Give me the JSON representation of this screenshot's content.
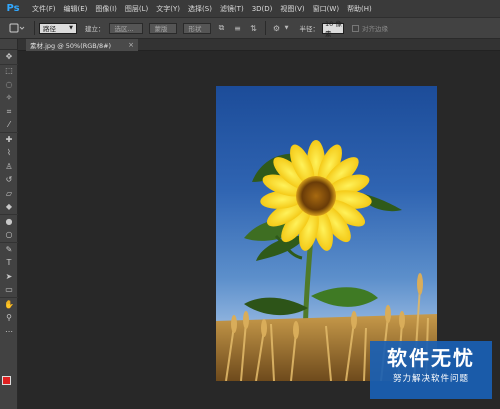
{
  "app": {
    "logo": "Ps"
  },
  "menu": [
    "文件(F)",
    "编辑(E)",
    "图像(I)",
    "图层(L)",
    "文字(Y)",
    "选择(S)",
    "滤镜(T)",
    "3D(D)",
    "视图(V)",
    "窗口(W)",
    "帮助(H)"
  ],
  "options": {
    "mode_value": "路径",
    "build_label": "建立：",
    "selection_btn": "选区...",
    "mask_btn": "蒙版",
    "shape_btn": "形状",
    "radius_label": "半径：",
    "radius_value": "10 像素",
    "align_edges_label": "对齐边缘"
  },
  "document": {
    "tab_title": "素材.jpg @ 50%(RGB/8#)",
    "close_glyph": "×"
  },
  "tools": [
    {
      "name": "move-tool-icon",
      "glyph": "✥"
    },
    {
      "name": "marquee-tool-icon",
      "glyph": "⬚"
    },
    {
      "name": "lasso-tool-icon",
      "glyph": "◌"
    },
    {
      "name": "magic-wand-tool-icon",
      "glyph": "✧"
    },
    {
      "name": "crop-tool-icon",
      "glyph": "⌗"
    },
    {
      "name": "eyedropper-tool-icon",
      "glyph": "⁄"
    },
    {
      "name": "healing-brush-tool-icon",
      "glyph": "✚"
    },
    {
      "name": "brush-tool-icon",
      "glyph": "⌇"
    },
    {
      "name": "clone-stamp-tool-icon",
      "glyph": "♙"
    },
    {
      "name": "history-brush-tool-icon",
      "glyph": "↺"
    },
    {
      "name": "eraser-tool-icon",
      "glyph": "▱"
    },
    {
      "name": "paint-bucket-tool-icon",
      "glyph": "◆"
    },
    {
      "name": "blur-tool-icon",
      "glyph": "●"
    },
    {
      "name": "dodge-tool-icon",
      "glyph": "○"
    },
    {
      "name": "pen-tool-icon",
      "glyph": "✎"
    },
    {
      "name": "type-tool-icon",
      "glyph": "T"
    },
    {
      "name": "path-selection-tool-icon",
      "glyph": "➤"
    },
    {
      "name": "rectangle-tool-icon",
      "glyph": "▭"
    },
    {
      "name": "hand-tool-icon",
      "glyph": "✋"
    },
    {
      "name": "zoom-tool-icon",
      "glyph": "⚲"
    },
    {
      "name": "extra-tool-icon",
      "glyph": "⋯"
    }
  ],
  "colors": {
    "foreground": "#e02020",
    "background": "#ffffff"
  },
  "watermark": {
    "title": "软件无忧",
    "subtitle": "努力解决软件问题"
  }
}
